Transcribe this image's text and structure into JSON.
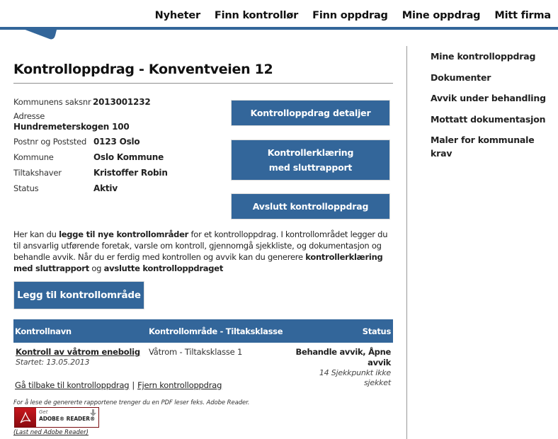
{
  "nav": {
    "items": [
      "Nyheter",
      "Finn kontrollør",
      "Finn oppdrag",
      "Mine oppdrag",
      "Mitt firma"
    ]
  },
  "page": {
    "title": "Kontrolloppdrag - Konventveien 12"
  },
  "info": {
    "saksnr_label": "Kommunens saksnr",
    "saksnr_value": "2013001232",
    "adresse_label": "Adresse",
    "adresse_value": "Hundremeterskogen 100",
    "post_label": "Postnr og Poststed",
    "post_value": "0123 Oslo",
    "kommune_label": "Kommune",
    "kommune_value": "Oslo Kommune",
    "tiltakshaver_label": "Tiltakshaver",
    "tiltakshaver_value": "Kristoffer Robin",
    "status_label": "Status",
    "status_value": "Aktiv"
  },
  "actions": {
    "details": "Kontrolloppdrag detaljer",
    "declaration": "Kontrollerklæring med sluttrapport",
    "finish": "Avslutt kontrolloppdrag"
  },
  "description": {
    "p1": "Her kan du ",
    "b1": "legge til nye kontrollområder",
    "p2": " for et kontrolloppdrag. I kontrollområdet legger du til ansvarlig utførende foretak, varsle om kontroll, gjennomgå sjekkliste, og dokumentasjon og behandle avvik. Når du er ferdig med kontrollen og avvik kan du generere ",
    "b2": "kontrollerklæring med sluttrapport",
    "p3": " og ",
    "b3": "avslutte kontrolloppdraget"
  },
  "add_button": "Legg til kontrollområde",
  "table": {
    "headers": [
      "Kontrollnavn",
      "Kontrollområde - Tiltaksklasse",
      "Status"
    ],
    "rows": [
      {
        "name": "Kontroll av våtrom enebolig",
        "started": "Startet: 13.05.2013",
        "area": "Våtrom - Tiltaksklasse 1",
        "status": "Behandle avvik, Åpne avvik",
        "status_sub": "14 Sjekkpunkt ikke sjekket"
      }
    ]
  },
  "links": {
    "back": "Gå tilbake til kontrolloppdrag",
    "separator": "|",
    "remove": "Fjern kontrolloppdrag"
  },
  "pdf": {
    "note": "For å lese de genererte rapportene trenger du en PDF leser feks. Adobe Reader.",
    "badge_get": "Get",
    "badge_name": "ADOBE® READER®",
    "download_link": "(Last ned Adobe Reader)"
  },
  "sidebar": {
    "items": [
      "Mine kontrolloppdrag",
      "Dokumenter",
      "Avvik under behandling",
      "Mottatt dokumentasjon",
      "Maler for kommunale krav"
    ]
  },
  "colors": {
    "brand_blue": "#33669a",
    "adobe_red": "#c8161d"
  }
}
